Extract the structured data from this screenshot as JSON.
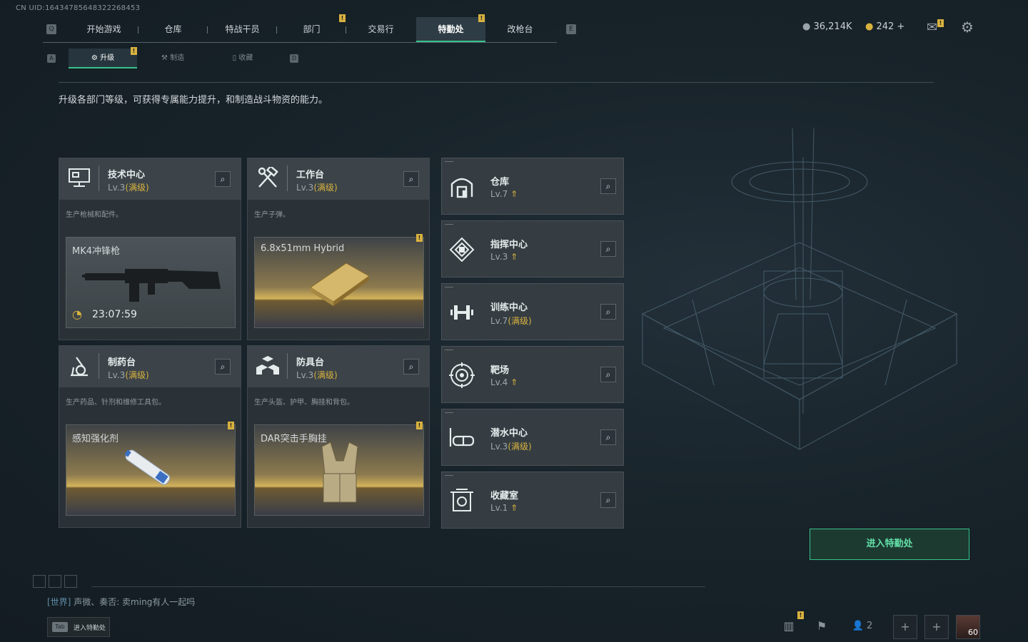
{
  "uid": "CN UID:16434785648322268453",
  "nav": {
    "left_key": "Q",
    "right_key": "E",
    "tabs": [
      {
        "label": "开始游戏"
      },
      {
        "label": "仓库"
      },
      {
        "label": "特战干员"
      },
      {
        "label": "部门"
      },
      {
        "label": "交易行"
      },
      {
        "label": "特勤处"
      },
      {
        "label": "改枪台"
      }
    ],
    "active": "特勤处"
  },
  "subnav": {
    "left_key": "A",
    "right_key": "D",
    "tabs": [
      {
        "label": "升级"
      },
      {
        "label": "制造"
      },
      {
        "label": "收藏"
      }
    ],
    "active": "升级"
  },
  "currency": {
    "coins": "36,214K",
    "gold": "242 +"
  },
  "badge": "!",
  "description": "升级各部门等级，可获得专属能力提升，和制造战斗物资的能力。",
  "cards": [
    {
      "name": "技术中心",
      "level": "Lv.3",
      "max": "(满级)",
      "text": "生产枪械和配件。",
      "product": "MK4冲锋枪",
      "timer": "23:07:59",
      "icon": "computer-icon"
    },
    {
      "name": "工作台",
      "level": "Lv.3",
      "max": "(满级)",
      "text": "生产子弹。",
      "product": "6.8x51mm Hybrid",
      "icon": "hammer-wrench-icon"
    },
    {
      "name": "制药台",
      "level": "Lv.3",
      "max": "(满级)",
      "text": "生产药品、针剂和维修工具包。",
      "product": "感知强化剂",
      "icon": "microscope-icon"
    },
    {
      "name": "防具台",
      "level": "Lv.3",
      "max": "(满级)",
      "text": "生产头盔、护甲、胸挂和背包。",
      "product": "DAR突击手胸挂",
      "icon": "cubes-icon"
    }
  ],
  "facilities": [
    {
      "name": "仓库",
      "level": "Lv.7",
      "max": "",
      "icon": "warehouse-icon"
    },
    {
      "name": "指挥中心",
      "level": "Lv.3",
      "max": "",
      "icon": "command-icon"
    },
    {
      "name": "训练中心",
      "level": "Lv.7",
      "max": "(满级)",
      "icon": "dumbbell-icon"
    },
    {
      "name": "靶场",
      "level": "Lv.4",
      "max": "",
      "icon": "target-icon"
    },
    {
      "name": "潜水中心",
      "level": "Lv.3",
      "max": "(满级)",
      "icon": "goggles-icon"
    },
    {
      "name": "收藏室",
      "level": "Lv.1",
      "max": "",
      "icon": "collection-icon"
    }
  ],
  "enter_button": "进入特勤处",
  "chat": {
    "channel": "[世界]",
    "message": "声微、奏否: 卖ming有人一起吗"
  },
  "tab_hint": {
    "key": "Tab",
    "label": "进入特勤处"
  },
  "bottom": {
    "friends": "2",
    "level": "60"
  }
}
